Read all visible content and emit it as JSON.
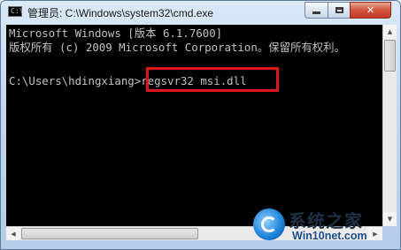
{
  "window": {
    "title": "管理员: C:\\Windows\\system32\\cmd.exe",
    "icon": "cmd-icon",
    "icon_prompt": "C:\\"
  },
  "controls": {
    "minimize": "minimize-icon",
    "maximize": "maximize-icon",
    "close": "close-icon",
    "close_glyph": "✕"
  },
  "console": {
    "lines": [
      "Microsoft Windows [版本 6.1.7600]",
      "版权所有 (c) 2009 Microsoft Corporation。保留所有权利。",
      "",
      "C:\\Users\\hdingxiang>regsvr32 msi.dll"
    ],
    "colors": {
      "background": "#000000",
      "foreground": "#c0c0c0",
      "highlight": "#e0141b"
    }
  },
  "scrollbars": {
    "up_glyph": "▲",
    "down_glyph": "▼",
    "left_glyph": "◀",
    "right_glyph": "▶"
  },
  "watermark": {
    "title": "系统之家",
    "url": "Win10net.com"
  }
}
